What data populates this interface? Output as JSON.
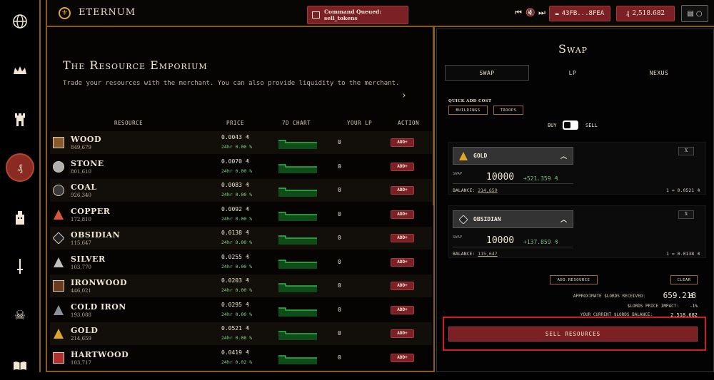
{
  "app": {
    "name": "ETERNUM"
  },
  "topbar": {
    "command_queue": "Command Queued: sell_tokens",
    "address": "43FB...8FEA",
    "lords_balance": "2,518.682"
  },
  "market": {
    "title": "The Resource Emporium",
    "subtitle": "Trade your resources with the merchant. You can also provide liquidity to the merchant.",
    "columns": [
      "RESOURCE",
      "PRICE",
      "7D CHART",
      "YOUR LP",
      "ACTION"
    ],
    "add_label": "ADD+",
    "rows": [
      {
        "name": "WOOD",
        "balance": "849,679",
        "price": "0.0043",
        "change": "24hr 0.00 %",
        "lp": "0",
        "color": "#8b5a2b"
      },
      {
        "name": "STONE",
        "balance": "801,610",
        "price": "0.0070",
        "change": "24hr 0.00 %",
        "lp": "0",
        "color": "#b0b0b0"
      },
      {
        "name": "COAL",
        "balance": "926,340",
        "price": "0.0083",
        "change": "24hr 0.00 %",
        "lp": "0",
        "color": "#3a3a3a"
      },
      {
        "name": "COPPER",
        "balance": "172,810",
        "price": "0.0092",
        "change": "24hr 0.00 %",
        "lp": "0",
        "color": "#d8553a"
      },
      {
        "name": "OBSIDIAN",
        "balance": "115,647",
        "price": "0.0138",
        "change": "24hr 0.00 %",
        "lp": "0",
        "color": "#555"
      },
      {
        "name": "SILVER",
        "balance": "103,770",
        "price": "0.0255",
        "change": "24hr 0.00 %",
        "lp": "0",
        "color": "#c0c0c0"
      },
      {
        "name": "IRONWOOD",
        "balance": "446,021",
        "price": "0.0203",
        "change": "24hr 0.00 %",
        "lp": "0",
        "color": "#6b3b1f"
      },
      {
        "name": "COLD IRON",
        "balance": "193,088",
        "price": "0.0295",
        "change": "24hr 0.00 %",
        "lp": "0",
        "color": "#8a8f99"
      },
      {
        "name": "GOLD",
        "balance": "214,659",
        "price": "0.0521",
        "change": "24hr 0.08 %",
        "lp": "0",
        "color": "#e0a526"
      },
      {
        "name": "HARTWOOD",
        "balance": "103,717",
        "price": "0.0419",
        "change": "24hr 0.02 %",
        "lp": "0",
        "color": "#b32e2e"
      }
    ]
  },
  "swap": {
    "title": "Swap",
    "tabs": [
      "SWAP",
      "LP",
      "NEXUS"
    ],
    "quick_add_label": "QUICK ADD COST",
    "quick_buttons": [
      "BUILDINGS",
      "TROOPS"
    ],
    "toggle": {
      "left": "BUY",
      "right": "SELL"
    },
    "swap_label": "SWAP",
    "balance_label": "BALANCE:",
    "x_label": "X",
    "cards": [
      {
        "resource": "GOLD",
        "amount": "10000",
        "delta": "+521.359",
        "balance": "214,659",
        "rate": "1 = 0.0521"
      },
      {
        "resource": "OBSIDIAN",
        "amount": "10000",
        "delta": "+137.859",
        "balance": "115,647",
        "rate": "1 = 0.0138"
      }
    ],
    "add_resource": "ADD RESOURCE",
    "clear": "CLEAR",
    "approx_label": "APPROXIMATE $LORDS RECEIVED:",
    "approx_value": "659.218",
    "impact_label": "$LORDS PRICE IMPACT:",
    "impact_value": "-1%",
    "current_label": "YOUR CURRENT $LORDS BALANCE:",
    "current_value": "2,518.682",
    "sell_button": "SELL RESOURCES"
  }
}
